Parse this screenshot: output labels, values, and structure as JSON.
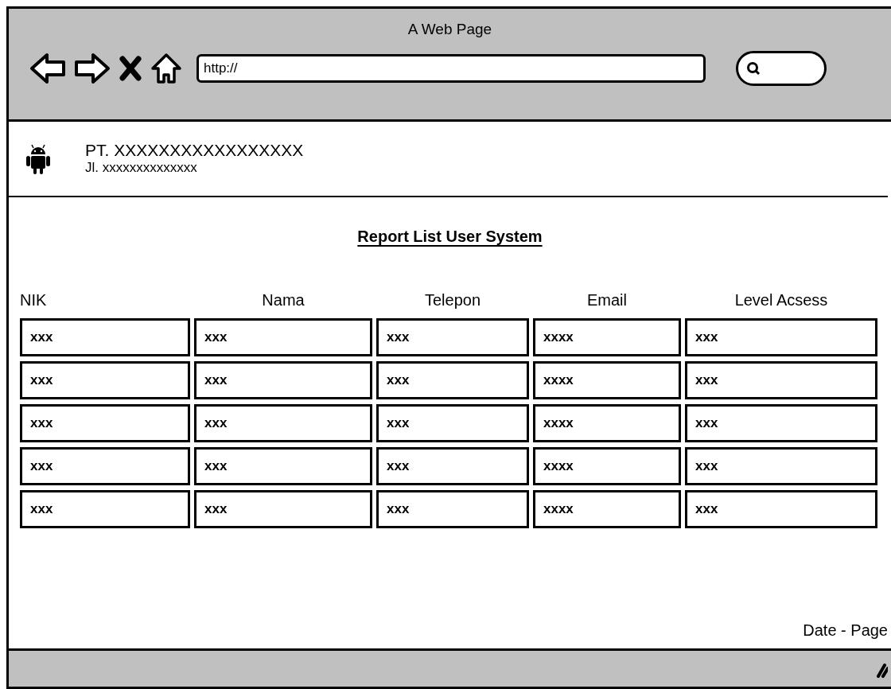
{
  "window": {
    "title": "A Web Page"
  },
  "browser": {
    "url": "http://"
  },
  "header": {
    "company": "PT. XXXXXXXXXXXXXXXXX",
    "address": "Jl. xxxxxxxxxxxxxx"
  },
  "report": {
    "title": "Report List User System"
  },
  "table": {
    "columns": [
      "NIK",
      "Nama",
      "Telepon",
      "Email",
      "Level Acsess"
    ],
    "rows": [
      [
        "xxx",
        "xxx",
        "xxx",
        "xxxx",
        "xxx"
      ],
      [
        "xxx",
        "xxx",
        "xxx",
        "xxxx",
        "xxx"
      ],
      [
        "xxx",
        "xxx",
        "xxx",
        "xxxx",
        "xxx"
      ],
      [
        "xxx",
        "xxx",
        "xxx",
        "xxxx",
        "xxx"
      ],
      [
        "xxx",
        "xxx",
        "xxx",
        "xxxx",
        "xxx"
      ]
    ]
  },
  "footer": {
    "text": "Date - Page"
  }
}
